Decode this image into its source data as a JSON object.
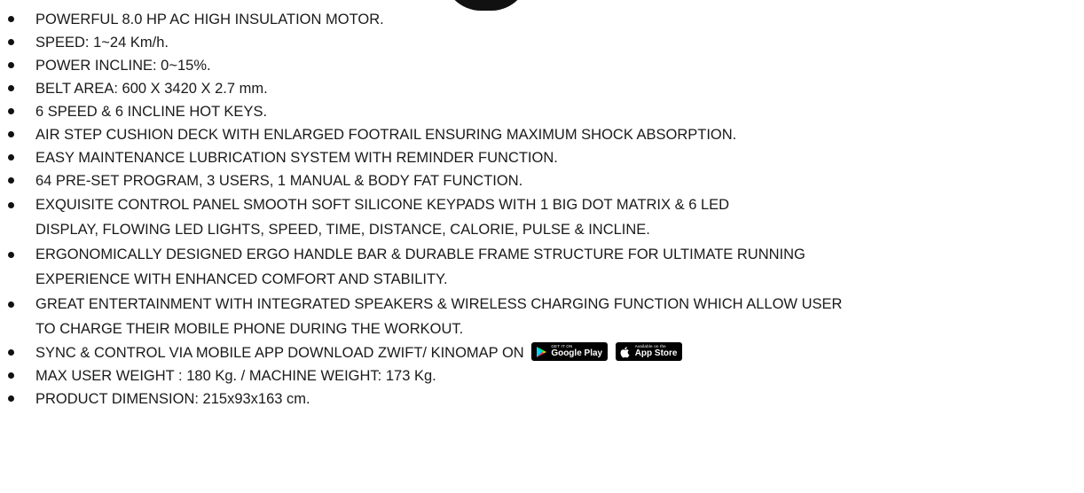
{
  "specs": {
    "items": [
      "POWERFUL 8.0 HP AC HIGH INSULATION MOTOR.",
      "SPEED: 1~24 Km/h.",
      "POWER INCLINE: 0~15%.",
      "BELT AREA: 600 X 3420 X 2.7 mm.",
      "6 SPEED & 6 INCLINE HOT KEYS.",
      "AIR STEP CUSHION DECK WITH ENLARGED FOOTRAIL ENSURING MAXIMUM SHOCK ABSORPTION.",
      "EASY MAINTENANCE LUBRICATION SYSTEM WITH REMINDER FUNCTION.",
      "64 PRE-SET PROGRAM, 3 USERS, 1 MANUAL & BODY FAT FUNCTION."
    ],
    "control_panel": {
      "line1": "EXQUISITE CONTROL PANEL SMOOTH SOFT SILICONE KEYPADS WITH 1 BIG DOT MATRIX & 6 LED",
      "line2": "DISPLAY, FLOWING LED LIGHTS, SPEED, TIME, DISTANCE, CALORIE, PULSE & INCLINE."
    },
    "handle_bar": {
      "line1": "ERGONOMICALLY DESIGNED ERGO HANDLE BAR & DURABLE FRAME STRUCTURE FOR ULTIMATE RUNNING",
      "line2": "EXPERIENCE WITH ENHANCED COMFORT AND STABILITY."
    },
    "entertainment": {
      "line1": "GREAT ENTERTAINMENT WITH INTEGRATED SPEAKERS & WIRELESS CHARGING FUNCTION WHICH ALLOW USER",
      "line2": "TO CHARGE THEIR MOBILE PHONE DURING THE WORKOUT."
    },
    "sync": {
      "text": "SYNC & CONTROL VIA MOBILE APP DOWNLOAD ZWIFT/ KINOMAP ON",
      "google_play": {
        "small": "GET IT ON",
        "big": "Google Play",
        "icon": "google-play-icon"
      },
      "app_store": {
        "small": "Available on the",
        "big": "App Store",
        "icon": "apple-icon"
      }
    },
    "weight": "MAX USER WEIGHT : 180 Kg. / MACHINE WEIGHT: 173 Kg.",
    "dimension": "PRODUCT DIMENSION: 215x93x163 cm."
  },
  "colors": {
    "text": "#1a1a1a",
    "bullet": "#111111",
    "badge_background": "#000000",
    "badge_text": "#ffffff"
  }
}
